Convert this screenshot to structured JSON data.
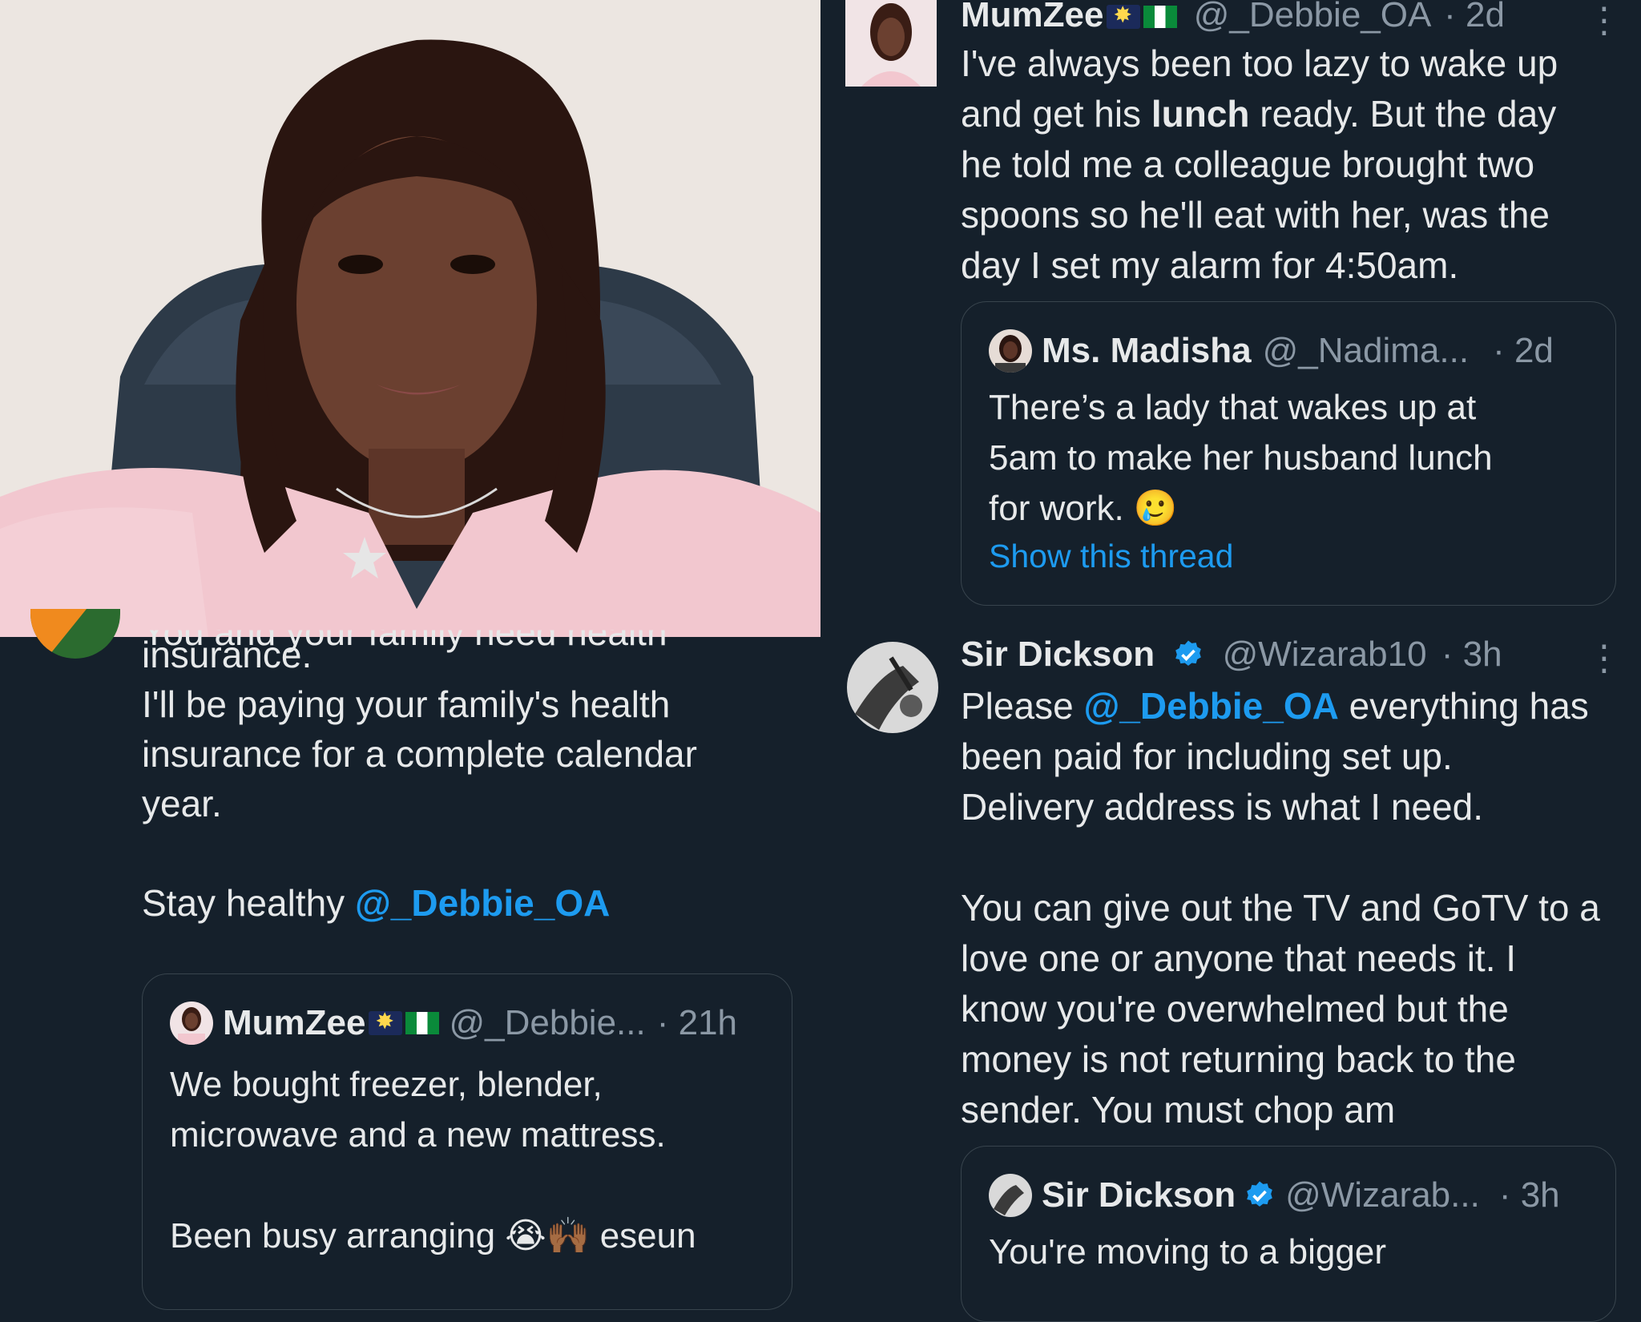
{
  "left_tweet": {
    "cut_line": "You and your family need health",
    "lines": [
      "insurance.",
      "I'll be paying your family's health",
      "insurance for a complete calendar",
      "year."
    ],
    "stay_text": "Stay healthy ",
    "mention": "@_Debbie_OA",
    "quote": {
      "name": "MumZee",
      "handle": "@_Debbie...",
      "time": "· 21h",
      "lines": [
        "We bought freezer, blender,",
        "microwave and a new mattress."
      ],
      "last_line_pre": "Been busy arranging ",
      "emoji": "😭🙌🏾",
      "last_line_post": " eseun"
    }
  },
  "right_tweet_1": {
    "name": "MumZee",
    "handle": "@_Debbie_OA",
    "time": "· 2d",
    "more": "⋮",
    "line1": "I've always been too lazy to wake up",
    "line2_pre": "and get his ",
    "line2_bold": "lunch",
    "line2_post": " ready. But the day",
    "line3": "he told me a colleague brought two",
    "line4": "spoons so he'll eat with her, was the",
    "line5": "day I set my alarm for 4:50am.",
    "quote": {
      "name": "Ms. Madisha",
      "handle": "@_Nadima...",
      "time": "· 2d",
      "lines": [
        "There’s a lady that wakes up at",
        "5am to make her husband lunch"
      ],
      "last_line": "for work. ",
      "emoji": "🥲",
      "show_thread": "Show this thread"
    }
  },
  "right_tweet_2": {
    "name": "Sir Dickson",
    "handle": "@Wizarab10",
    "time": "· 3h",
    "more": "⋮",
    "line1_pre": "Please ",
    "line1_mention": "@_Debbie_OA",
    "line1_post": " everything has",
    "lines_a": [
      "been paid for including set up.",
      "Delivery address is what I need."
    ],
    "lines_b": [
      "You can give out the TV and GoTV to a",
      "love one or anyone that needs it. I",
      "know you're overwhelmed but the",
      "money is not returning back to the",
      "sender. You must chop am"
    ],
    "quote": {
      "name": "Sir Dickson",
      "handle": "@Wizarab...",
      "time": "· 3h",
      "line": "You're moving to a bigger"
    }
  },
  "colors": {
    "background": "#15202b",
    "text": "#e7e9ea",
    "muted": "#8b98a5",
    "link": "#1d9bf0",
    "border": "#38444d"
  }
}
